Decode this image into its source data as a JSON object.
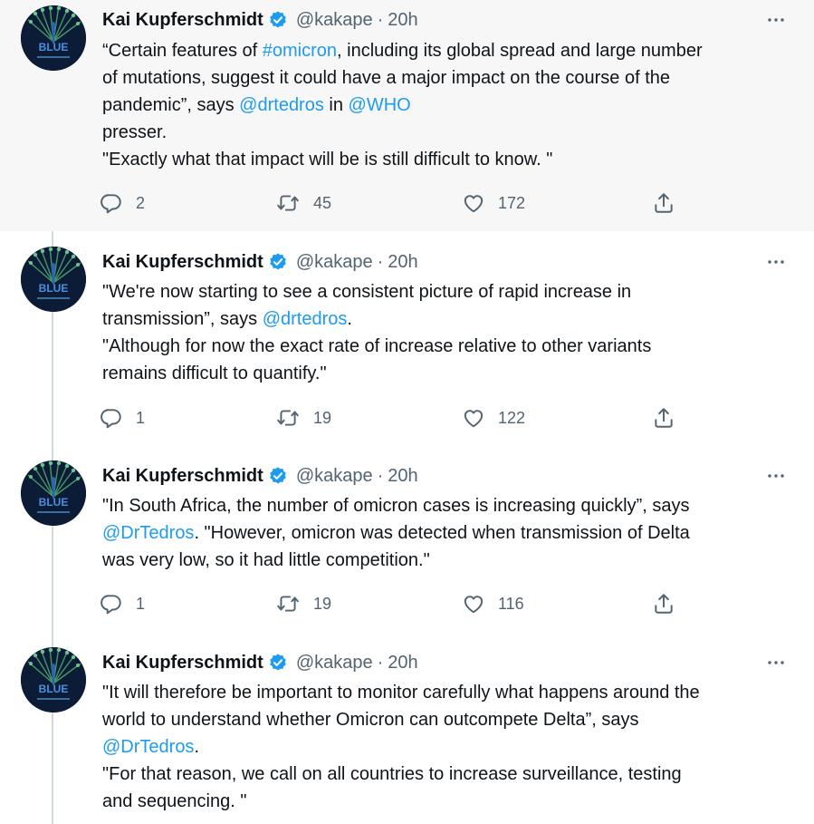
{
  "tweets": [
    {
      "author": "Kai Kupferschmidt",
      "handle": "@kakape",
      "time": "20h",
      "lines": [
        [
          {
            "t": "“Certain features of "
          },
          {
            "t": "#omicron",
            "link": true
          },
          {
            "t": ", including its global spread and large number"
          }
        ],
        [
          {
            "t": "of mutations, suggest it could have a major impact on the course of the"
          }
        ],
        [
          {
            "t": "pandemic”, says "
          },
          {
            "t": "@drtedros",
            "link": true
          },
          {
            "t": " in "
          },
          {
            "t": "@WHO",
            "link": true
          }
        ],
        [
          {
            "t": "presser."
          }
        ],
        [
          {
            "t": "\"Exactly what that impact will be is still difficult to know. \""
          }
        ]
      ],
      "replies": "2",
      "retweets": "45",
      "likes": "172"
    },
    {
      "author": "Kai Kupferschmidt",
      "handle": "@kakape",
      "time": "20h",
      "lines": [
        [
          {
            "t": "\"We're now starting to see a consistent picture of rapid increase in"
          }
        ],
        [
          {
            "t": "transmission”, says "
          },
          {
            "t": "@drtedros",
            "link": true
          },
          {
            "t": "."
          }
        ],
        [
          {
            "t": "\"Although for now the exact rate of increase relative to other variants"
          }
        ],
        [
          {
            "t": "remains difficult to quantify.\""
          }
        ]
      ],
      "replies": "1",
      "retweets": "19",
      "likes": "122"
    },
    {
      "author": "Kai Kupferschmidt",
      "handle": "@kakape",
      "time": "20h",
      "lines": [
        [
          {
            "t": "\"In South Africa, the number of omicron cases is increasing quickly”, says"
          }
        ],
        [
          {
            "t": "@DrTedros",
            "link": true
          },
          {
            "t": ". \"However, omicron was detected when transmission of Delta"
          }
        ],
        [
          {
            "t": "was very low, so it had little competition.\""
          }
        ]
      ],
      "replies": "1",
      "retweets": "19",
      "likes": "116"
    },
    {
      "author": "Kai Kupferschmidt",
      "handle": "@kakape",
      "time": "20h",
      "lines": [
        [
          {
            "t": "\"It will therefore be important to monitor carefully what happens around the"
          }
        ],
        [
          {
            "t": "world to understand whether Omicron can outcompete Delta”, says"
          }
        ],
        [
          {
            "t": "@DrTedros",
            "link": true
          },
          {
            "t": "."
          }
        ],
        [
          {
            "t": "\"For that reason, we call on all countries to increase surveillance, testing"
          }
        ],
        [
          {
            "t": "and sequencing. \""
          }
        ]
      ],
      "replies": null,
      "retweets": null,
      "likes": null
    }
  ],
  "separator": "·",
  "avatar_text": "BLUE",
  "icons": {
    "verified": "verified-badge-icon",
    "more": "more-dots-icon",
    "reply": "reply-icon",
    "retweet": "retweet-icon",
    "like": "heart-icon",
    "share": "share-icon"
  },
  "colors": {
    "link": "#1d9bf0",
    "verified": "#1d9bf0",
    "muted": "#536471",
    "highlight_bg": "#f7f7f7"
  }
}
